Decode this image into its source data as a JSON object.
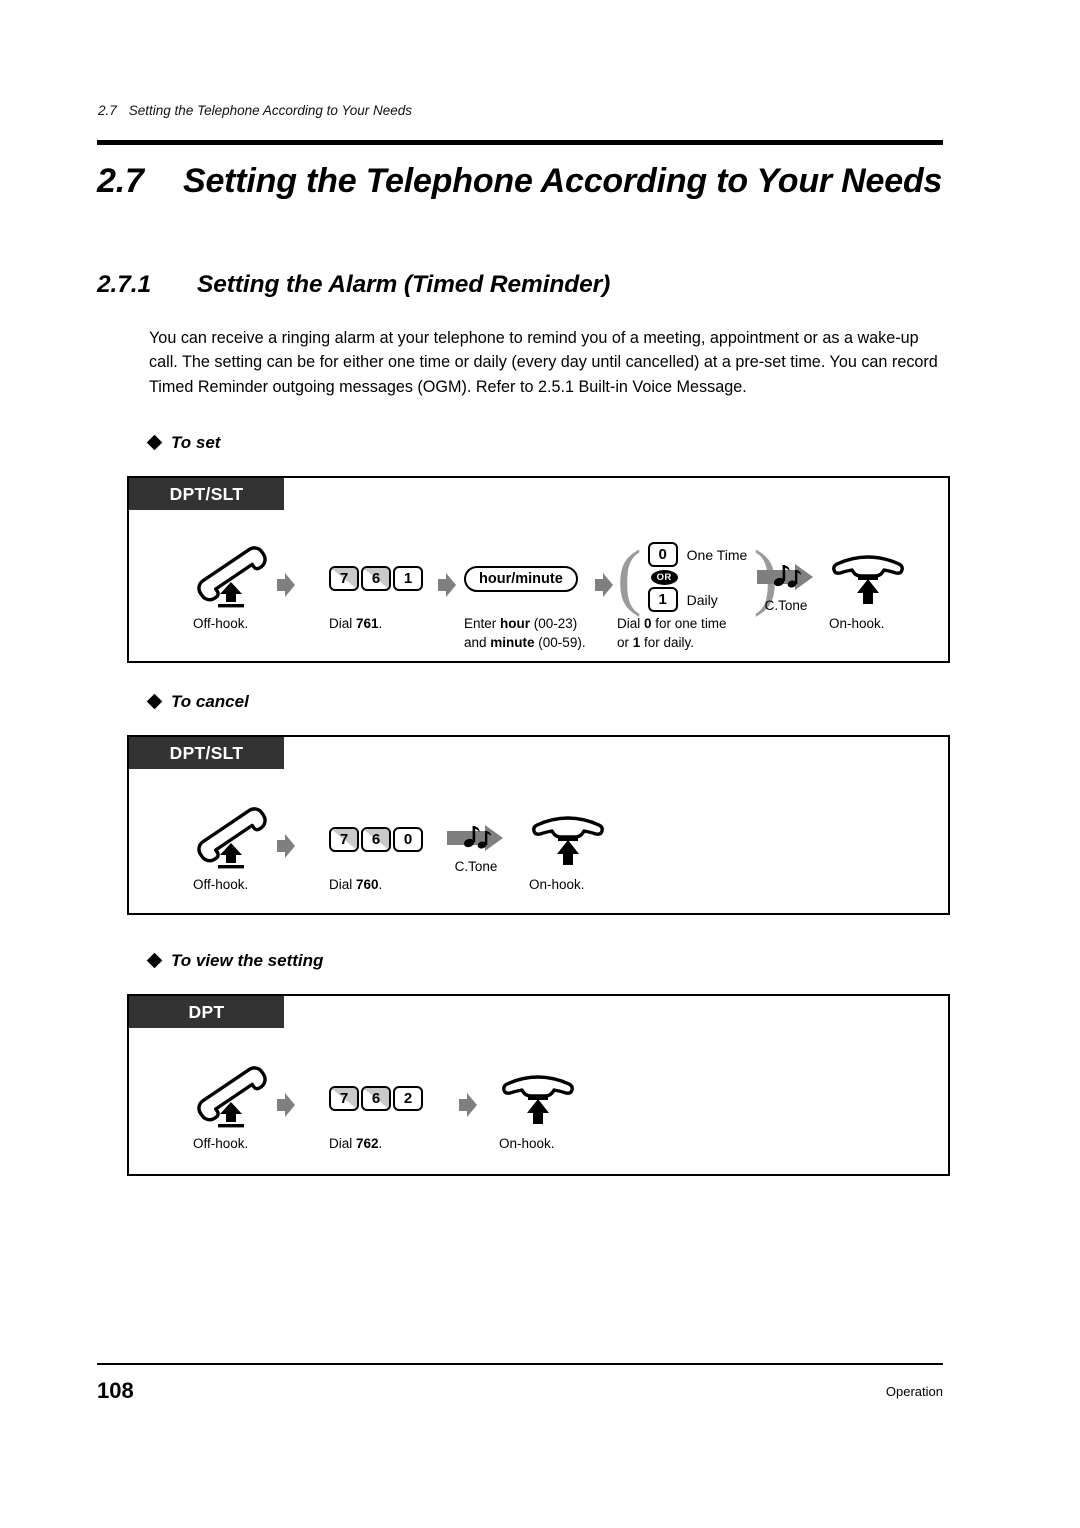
{
  "running_header": {
    "number": "2.7",
    "title": "Setting the Telephone According to Your Needs"
  },
  "chapter": {
    "number": "2.7",
    "title": "Setting the Telephone According to Your Needs"
  },
  "section": {
    "number": "2.7.1",
    "title": "Setting the Alarm (Timed Reminder)"
  },
  "body": {
    "paragraph": "You can receive a ringing alarm at your telephone to remind you of a meeting, appointment or as a wake-up call. The setting can be for either one time or daily (every day until cancelled) at a pre-set time. You can record Timed Reminder outgoing messages (OGM). Refer to 2.5.1   Built-in Voice Message."
  },
  "procedures": [
    {
      "heading": "To set",
      "phone_types": "DPT/SLT",
      "steps": [
        {
          "kind": "offhook",
          "caption": "Off-hook."
        },
        {
          "kind": "keys",
          "keys": [
            {
              "label": "7",
              "shaded": true
            },
            {
              "label": "6",
              "shaded": true
            },
            {
              "label": "1",
              "shaded": false
            }
          ],
          "caption_lines": [
            "Dial <b>761</b>."
          ]
        },
        {
          "kind": "pill",
          "pill_label": "hour/minute",
          "caption_lines": [
            "Enter <b>hour</b> (00-23)",
            "and <b>minute</b> (00-59)."
          ]
        },
        {
          "kind": "choice",
          "options": [
            {
              "key": "0",
              "label": "One Time"
            },
            {
              "key": "1",
              "label": "Daily"
            }
          ],
          "or_label": "OR",
          "caption_lines": [
            "Dial <b>0</b> for one time",
            "or <b>1</b> for daily."
          ]
        },
        {
          "kind": "ctone",
          "ctone_label": "C.Tone"
        },
        {
          "kind": "onhook",
          "caption": "On-hook."
        }
      ]
    },
    {
      "heading": "To cancel",
      "phone_types": "DPT/SLT",
      "steps": [
        {
          "kind": "offhook",
          "caption": "Off-hook."
        },
        {
          "kind": "keys",
          "keys": [
            {
              "label": "7",
              "shaded": true
            },
            {
              "label": "6",
              "shaded": true
            },
            {
              "label": "0",
              "shaded": false
            }
          ],
          "caption_lines": [
            "Dial <b>760</b>."
          ]
        },
        {
          "kind": "ctone",
          "ctone_label": "C.Tone"
        },
        {
          "kind": "onhook",
          "caption": "On-hook."
        }
      ]
    },
    {
      "heading": "To view the setting",
      "phone_types": "DPT",
      "steps": [
        {
          "kind": "offhook",
          "caption": "Off-hook."
        },
        {
          "kind": "keys",
          "keys": [
            {
              "label": "7",
              "shaded": true
            },
            {
              "label": "6",
              "shaded": true
            },
            {
              "label": "2",
              "shaded": false
            }
          ],
          "caption_lines": [
            "Dial <b>762</b>."
          ]
        },
        {
          "kind": "onhook",
          "caption": "On-hook."
        }
      ]
    }
  ],
  "footer": {
    "page_number": "108",
    "label": "Operation"
  }
}
